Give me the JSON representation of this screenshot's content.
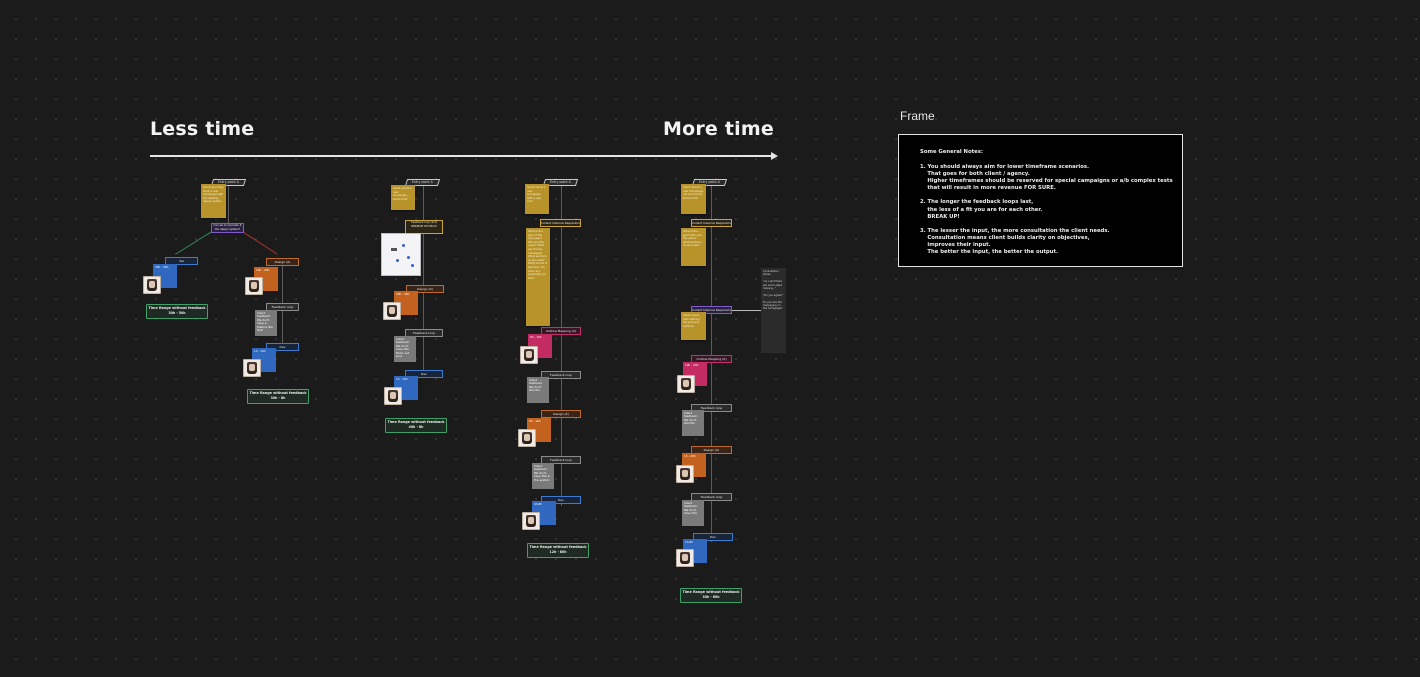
{
  "timeline": {
    "left_label": "Less time",
    "right_label": "More time"
  },
  "frame": {
    "label": "Frame",
    "notes_title": "Some General Notes:",
    "notes": [
      "1. You should always aim for lower timeframe scenarios.\n    That goes for both client / agency.\n    Higher timeframes should be reserved for special campaigns or a/b complex tests\n    that will result in more revenue FOR SURE.",
      "2. The longer the feedback loops last,\n    the less of a fit you are for each other.\n    BREAK UP!",
      "3. The lesser the input, the more consultation the client needs.\n    Consultation means client builds clarity on objectives,\n    improves their input.\n    The better the input, the better the output."
    ]
  },
  "common": {
    "entry_point": "Entry point A",
    "time_label": "Time Range without feedback",
    "feedback_loop": "Feedback loop",
    "collect_reqs": "Collect Internal Requirements",
    "design": "Design (X)",
    "dev": "Dev",
    "copy": "Copy (X)",
    "wireframes": "Outline Mapping (X)"
  },
  "scenarios": [
    {
      "time_value": "30h - 50h",
      "decision": "Can we incorporate it the design system?",
      "yes_tile": "30h - 50h",
      "design_tile": "10h - 20h",
      "dev_tile": "1h - 10h",
      "time_value_b": "30h - 8h"
    },
    {
      "time_value": "40h - 8h",
      "fb": "Feedback loop (1/3) MINIMUM 8H DELAY",
      "design_tile": "20h - 30h",
      "dev_tile": "1h - 10h"
    },
    {
      "time_value": "12h - 80h",
      "wire_tile": "8h - 10h",
      "design_tile": "8h - 16h",
      "dev_tile": "4h-8h"
    },
    {
      "time_value": "30h - 60h",
      "wire_tile": "10h - 20h",
      "design_tile": "1h - 20h",
      "dev_tile": "1h-8h"
    }
  ],
  "side_note": {
    "lines": [
      "Consultation phase",
      "\"As I said there are some steps missing...\"",
      "\"Do you agree?\"",
      "Do you like the messaging on the homepage?"
    ]
  }
}
